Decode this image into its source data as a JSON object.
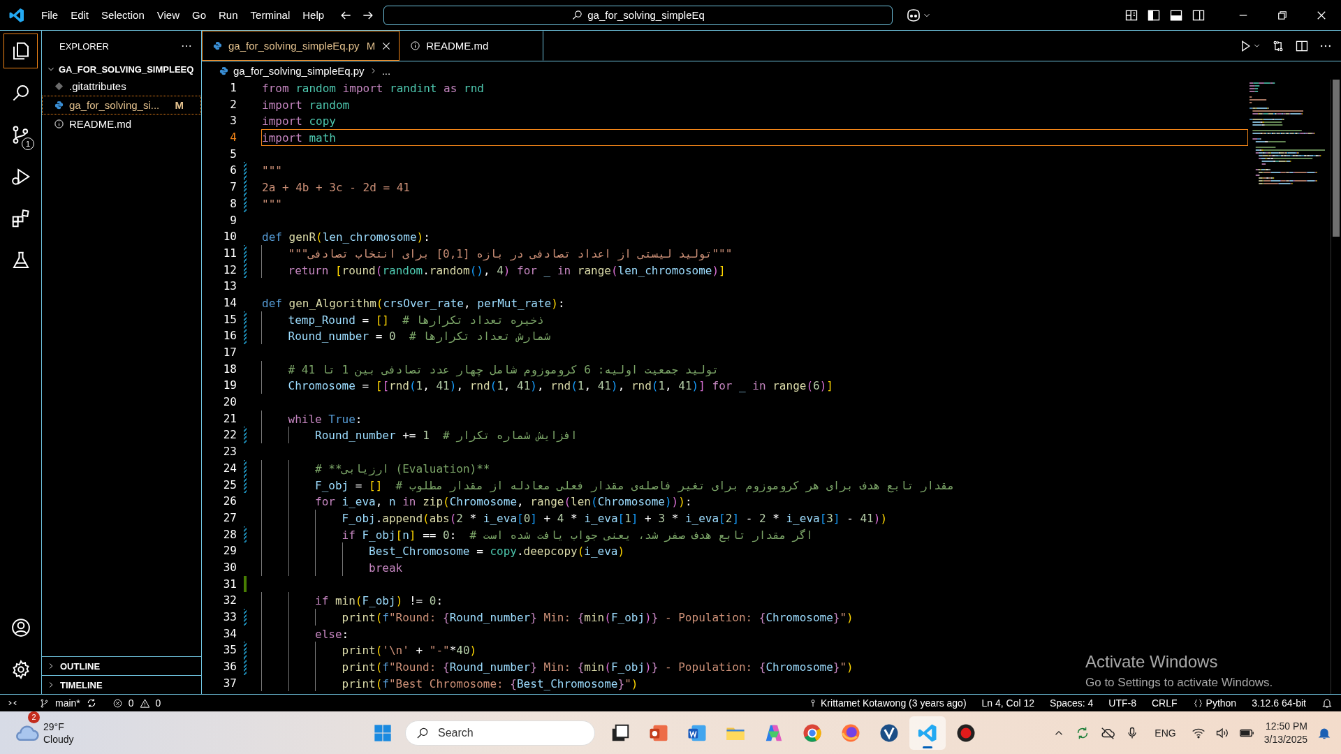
{
  "title_bar": {
    "menu": [
      "File",
      "Edit",
      "Selection",
      "View",
      "Go",
      "Run",
      "Terminal",
      "Help"
    ],
    "command_center": "ga_for_solving_simpleEq"
  },
  "activity_bar": {
    "items": [
      {
        "kind": "explorer",
        "selected": true
      },
      {
        "kind": "search",
        "selected": false
      },
      {
        "kind": "source-control",
        "selected": false,
        "badge": "1"
      },
      {
        "kind": "run",
        "selected": false
      },
      {
        "kind": "extensions",
        "selected": false
      },
      {
        "kind": "testing",
        "selected": false
      }
    ],
    "bottom": [
      {
        "kind": "account"
      },
      {
        "kind": "settings"
      }
    ]
  },
  "sidebar": {
    "title": "EXPLORER",
    "folder": {
      "name": "GA_FOR_SOLVING_SIMPLEEQ",
      "expanded": true,
      "children": [
        {
          "name": ".gitattributes",
          "kind": "git",
          "selected": false
        },
        {
          "name": "ga_for_solving_si...",
          "kind": "python",
          "selected": true,
          "status": "M"
        },
        {
          "name": "README.md",
          "kind": "info",
          "selected": false
        }
      ]
    },
    "sections": [
      {
        "name": "OUTLINE",
        "expanded": false
      },
      {
        "name": "TIMELINE",
        "expanded": false
      }
    ]
  },
  "tabs": [
    {
      "label": "ga_for_solving_simpleEq.py",
      "kind": "python",
      "status": "M",
      "selected": true
    },
    {
      "label": "README.md",
      "kind": "info",
      "selected": false
    }
  ],
  "breadcrumb": [
    "ga_for_solving_simpleEq.py",
    "..."
  ],
  "editor": {
    "lines": [
      {
        "number": "1",
        "tokens": [
          {
            "text": "from ",
            "kind": "keyword"
          },
          {
            "text": "random ",
            "kind": "module"
          },
          {
            "text": "import ",
            "kind": "keyword"
          },
          {
            "text": "randint ",
            "kind": "module"
          },
          {
            "text": "as ",
            "kind": "keyword"
          },
          {
            "text": "rnd",
            "kind": "module"
          }
        ]
      },
      {
        "number": "2",
        "tokens": [
          {
            "text": "import ",
            "kind": "keyword"
          },
          {
            "text": "random",
            "kind": "module"
          }
        ]
      },
      {
        "number": "3",
        "tokens": [
          {
            "text": "import ",
            "kind": "keyword"
          },
          {
            "text": "copy",
            "kind": "module"
          }
        ]
      },
      {
        "number": "4",
        "current": true,
        "tokens": [
          {
            "text": "import ",
            "kind": "keyword"
          },
          {
            "text": "math",
            "kind": "module"
          }
        ]
      },
      {
        "number": "5"
      },
      {
        "number": "6",
        "modified": true,
        "tokens": [
          {
            "text": "\"\"\"",
            "kind": "string"
          }
        ]
      },
      {
        "number": "7",
        "modified": true,
        "tokens": [
          {
            "text": "2a + 4b + 3c - 2d = 41",
            "kind": "string"
          }
        ]
      },
      {
        "number": "8",
        "modified": true,
        "tokens": [
          {
            "text": "\"\"\"",
            "kind": "string"
          }
        ]
      },
      {
        "number": "9"
      },
      {
        "number": "10",
        "tokens": [
          {
            "text": "def ",
            "kind": "storage"
          },
          {
            "text": "genR",
            "kind": "func"
          },
          {
            "text": "(",
            "kind": "br1"
          },
          {
            "text": "len_chromosome",
            "kind": "var"
          },
          {
            "text": ")",
            "kind": "br1"
          },
          {
            "text": ":",
            "kind": "plain"
          }
        ]
      },
      {
        "number": "11",
        "modified": true,
        "guides": [
          true
        ],
        "tokens": [
          {
            "text": "\"\"\"تولید لیستی از اعداد تصادفی در بازه [0,1] برای انتخاب تصادفی\"\"\"",
            "kind": "string"
          }
        ]
      },
      {
        "number": "12",
        "modified": true,
        "guides": [
          true
        ],
        "tokens": [
          {
            "text": "return ",
            "kind": "keyword"
          },
          {
            "text": "[",
            "kind": "br1"
          },
          {
            "text": "round",
            "kind": "func"
          },
          {
            "text": "(",
            "kind": "br2"
          },
          {
            "text": "random",
            "kind": "module"
          },
          {
            "text": ".",
            "kind": "plain"
          },
          {
            "text": "random",
            "kind": "func"
          },
          {
            "text": "()",
            "kind": "br3"
          },
          {
            "text": ", ",
            "kind": "plain"
          },
          {
            "text": "4",
            "kind": "number"
          },
          {
            "text": ")",
            "kind": "br2"
          },
          {
            "text": " for ",
            "kind": "keyword"
          },
          {
            "text": "_ ",
            "kind": "var"
          },
          {
            "text": "in ",
            "kind": "keyword"
          },
          {
            "text": "range",
            "kind": "func"
          },
          {
            "text": "(",
            "kind": "br2"
          },
          {
            "text": "len_chromosome",
            "kind": "var"
          },
          {
            "text": ")",
            "kind": "br2"
          },
          {
            "text": "]",
            "kind": "br1"
          }
        ]
      },
      {
        "number": "13"
      },
      {
        "number": "14",
        "tokens": [
          {
            "text": "def ",
            "kind": "storage"
          },
          {
            "text": "gen_Algorithm",
            "kind": "func"
          },
          {
            "text": "(",
            "kind": "br1"
          },
          {
            "text": "crsOver_rate",
            "kind": "var"
          },
          {
            "text": ", ",
            "kind": "plain"
          },
          {
            "text": "perMut_rate",
            "kind": "var"
          },
          {
            "text": ")",
            "kind": "br1"
          },
          {
            "text": ":",
            "kind": "plain"
          }
        ]
      },
      {
        "number": "15",
        "modified": true,
        "guides": [
          true
        ],
        "tokens": [
          {
            "text": "temp_Round",
            "kind": "var"
          },
          {
            "text": " = ",
            "kind": "plain"
          },
          {
            "text": "[]",
            "kind": "br1"
          },
          {
            "text": "  # ذخیره تعداد تکرارها",
            "kind": "comment"
          }
        ]
      },
      {
        "number": "16",
        "modified": true,
        "guides": [
          true
        ],
        "tokens": [
          {
            "text": "Round_number",
            "kind": "var"
          },
          {
            "text": " = ",
            "kind": "plain"
          },
          {
            "text": "0",
            "kind": "number"
          },
          {
            "text": "  # شمارش تعداد تکرارها",
            "kind": "comment"
          }
        ]
      },
      {
        "number": "17"
      },
      {
        "number": "18",
        "guides": [
          true
        ],
        "tokens": [
          {
            "text": "# تولید جمعیت اولیه: 6 کروموزوم شامل چهار عدد تصادفی بین 1 تا 41",
            "kind": "comment"
          }
        ]
      },
      {
        "number": "19",
        "guides": [
          true
        ],
        "tokens": [
          {
            "text": "Chromosome",
            "kind": "var"
          },
          {
            "text": " = ",
            "kind": "plain"
          },
          {
            "text": "[",
            "kind": "br1"
          },
          {
            "text": "[",
            "kind": "br2"
          },
          {
            "text": "rnd",
            "kind": "func"
          },
          {
            "text": "(",
            "kind": "br3"
          },
          {
            "text": "1",
            "kind": "number"
          },
          {
            "text": ", ",
            "kind": "plain"
          },
          {
            "text": "41",
            "kind": "number"
          },
          {
            "text": ")",
            "kind": "br3"
          },
          {
            "text": ", ",
            "kind": "plain"
          },
          {
            "text": "rnd",
            "kind": "func"
          },
          {
            "text": "(",
            "kind": "br3"
          },
          {
            "text": "1",
            "kind": "number"
          },
          {
            "text": ", ",
            "kind": "plain"
          },
          {
            "text": "41",
            "kind": "number"
          },
          {
            "text": ")",
            "kind": "br3"
          },
          {
            "text": ", ",
            "kind": "plain"
          },
          {
            "text": "rnd",
            "kind": "func"
          },
          {
            "text": "(",
            "kind": "br3"
          },
          {
            "text": "1",
            "kind": "number"
          },
          {
            "text": ", ",
            "kind": "plain"
          },
          {
            "text": "41",
            "kind": "number"
          },
          {
            "text": ")",
            "kind": "br3"
          },
          {
            "text": ", ",
            "kind": "plain"
          },
          {
            "text": "rnd",
            "kind": "func"
          },
          {
            "text": "(",
            "kind": "br3"
          },
          {
            "text": "1",
            "kind": "number"
          },
          {
            "text": ", ",
            "kind": "plain"
          },
          {
            "text": "41",
            "kind": "number"
          },
          {
            "text": ")",
            "kind": "br3"
          },
          {
            "text": "]",
            "kind": "br2"
          },
          {
            "text": " for ",
            "kind": "keyword"
          },
          {
            "text": "_ ",
            "kind": "var"
          },
          {
            "text": "in ",
            "kind": "keyword"
          },
          {
            "text": "range",
            "kind": "func"
          },
          {
            "text": "(",
            "kind": "br2"
          },
          {
            "text": "6",
            "kind": "number"
          },
          {
            "text": ")",
            "kind": "br2"
          },
          {
            "text": "]",
            "kind": "br1"
          }
        ]
      },
      {
        "number": "20"
      },
      {
        "number": "21",
        "guides": [
          true
        ],
        "tokens": [
          {
            "text": "while ",
            "kind": "keyword"
          },
          {
            "text": "True",
            "kind": "storage"
          },
          {
            "text": ":",
            "kind": "plain"
          }
        ]
      },
      {
        "number": "22",
        "modified": true,
        "guides": [
          true,
          true
        ],
        "tokens": [
          {
            "text": "Round_number",
            "kind": "var"
          },
          {
            "text": " += ",
            "kind": "plain"
          },
          {
            "text": "1",
            "kind": "number"
          },
          {
            "text": "  # افزایش شماره تکرار",
            "kind": "comment"
          }
        ]
      },
      {
        "number": "23"
      },
      {
        "number": "24",
        "modified": true,
        "guides": [
          true,
          true
        ],
        "tokens": [
          {
            "text": "# **ارزیابی (Evaluation)**",
            "kind": "comment"
          }
        ]
      },
      {
        "number": "25",
        "modified": true,
        "guides": [
          true,
          true
        ],
        "tokens": [
          {
            "text": "F_obj",
            "kind": "var"
          },
          {
            "text": " = ",
            "kind": "plain"
          },
          {
            "text": "[]",
            "kind": "br1"
          },
          {
            "text": "  # مقدار تابع هدف برای هر کروموزوم برای تغیر فاصله‌ی مقدار فعلی معادله از مقدار مطلوب",
            "kind": "comment"
          }
        ]
      },
      {
        "number": "26",
        "guides": [
          true,
          true
        ],
        "tokens": [
          {
            "text": "for ",
            "kind": "keyword"
          },
          {
            "text": "i_eva",
            "kind": "var"
          },
          {
            "text": ", ",
            "kind": "plain"
          },
          {
            "text": "n ",
            "kind": "var"
          },
          {
            "text": "in ",
            "kind": "keyword"
          },
          {
            "text": "zip",
            "kind": "func"
          },
          {
            "text": "(",
            "kind": "br1"
          },
          {
            "text": "Chromosome",
            "kind": "var"
          },
          {
            "text": ", ",
            "kind": "plain"
          },
          {
            "text": "range",
            "kind": "func"
          },
          {
            "text": "(",
            "kind": "br2"
          },
          {
            "text": "len",
            "kind": "func"
          },
          {
            "text": "(",
            "kind": "br3"
          },
          {
            "text": "Chromosome",
            "kind": "var"
          },
          {
            "text": ")",
            "kind": "br3"
          },
          {
            "text": ")",
            "kind": "br2"
          },
          {
            "text": ")",
            "kind": "br1"
          },
          {
            "text": ":",
            "kind": "plain"
          }
        ]
      },
      {
        "number": "27",
        "guides": [
          true,
          true,
          true
        ],
        "tokens": [
          {
            "text": "F_obj",
            "kind": "var"
          },
          {
            "text": ".",
            "kind": "plain"
          },
          {
            "text": "append",
            "kind": "func"
          },
          {
            "text": "(",
            "kind": "br1"
          },
          {
            "text": "abs",
            "kind": "func"
          },
          {
            "text": "(",
            "kind": "br2"
          },
          {
            "text": "2",
            "kind": "number"
          },
          {
            "text": " * ",
            "kind": "plain"
          },
          {
            "text": "i_eva",
            "kind": "var"
          },
          {
            "text": "[",
            "kind": "br3"
          },
          {
            "text": "0",
            "kind": "number"
          },
          {
            "text": "]",
            "kind": "br3"
          },
          {
            "text": " + ",
            "kind": "plain"
          },
          {
            "text": "4",
            "kind": "number"
          },
          {
            "text": " * ",
            "kind": "plain"
          },
          {
            "text": "i_eva",
            "kind": "var"
          },
          {
            "text": "[",
            "kind": "br3"
          },
          {
            "text": "1",
            "kind": "number"
          },
          {
            "text": "]",
            "kind": "br3"
          },
          {
            "text": " + ",
            "kind": "plain"
          },
          {
            "text": "3",
            "kind": "number"
          },
          {
            "text": " * ",
            "kind": "plain"
          },
          {
            "text": "i_eva",
            "kind": "var"
          },
          {
            "text": "[",
            "kind": "br3"
          },
          {
            "text": "2",
            "kind": "number"
          },
          {
            "text": "]",
            "kind": "br3"
          },
          {
            "text": " - ",
            "kind": "plain"
          },
          {
            "text": "2",
            "kind": "number"
          },
          {
            "text": " * ",
            "kind": "plain"
          },
          {
            "text": "i_eva",
            "kind": "var"
          },
          {
            "text": "[",
            "kind": "br3"
          },
          {
            "text": "3",
            "kind": "number"
          },
          {
            "text": "]",
            "kind": "br3"
          },
          {
            "text": " - ",
            "kind": "plain"
          },
          {
            "text": "41",
            "kind": "number"
          },
          {
            "text": ")",
            "kind": "br2"
          },
          {
            "text": ")",
            "kind": "br1"
          }
        ]
      },
      {
        "number": "28",
        "modified": true,
        "guides": [
          true,
          true,
          true
        ],
        "tokens": [
          {
            "text": "if ",
            "kind": "keyword"
          },
          {
            "text": "F_obj",
            "kind": "var"
          },
          {
            "text": "[",
            "kind": "br1"
          },
          {
            "text": "n",
            "kind": "var"
          },
          {
            "text": "]",
            "kind": "br1"
          },
          {
            "text": " == ",
            "kind": "plain"
          },
          {
            "text": "0",
            "kind": "number"
          },
          {
            "text": ":  ",
            "kind": "plain"
          },
          {
            "text": "# اگر مقدار تابع هدف صفر شد، یعنی جواب یافت شده است",
            "kind": "comment"
          }
        ]
      },
      {
        "number": "29",
        "guides": [
          true,
          true,
          true,
          true
        ],
        "tokens": [
          {
            "text": "Best_Chromosome",
            "kind": "var"
          },
          {
            "text": " = ",
            "kind": "plain"
          },
          {
            "text": "copy",
            "kind": "module"
          },
          {
            "text": ".",
            "kind": "plain"
          },
          {
            "text": "deepcopy",
            "kind": "func"
          },
          {
            "text": "(",
            "kind": "br1"
          },
          {
            "text": "i_eva",
            "kind": "var"
          },
          {
            "text": ")",
            "kind": "br1"
          }
        ]
      },
      {
        "number": "30",
        "guides": [
          true,
          true,
          true,
          true
        ],
        "tokens": [
          {
            "text": "break",
            "kind": "keyword"
          }
        ]
      },
      {
        "number": "31",
        "added": true
      },
      {
        "number": "32",
        "guides": [
          true,
          true
        ],
        "tokens": [
          {
            "text": "if ",
            "kind": "keyword"
          },
          {
            "text": "min",
            "kind": "func"
          },
          {
            "text": "(",
            "kind": "br1"
          },
          {
            "text": "F_obj",
            "kind": "var"
          },
          {
            "text": ")",
            "kind": "br1"
          },
          {
            "text": " != ",
            "kind": "plain"
          },
          {
            "text": "0",
            "kind": "number"
          },
          {
            "text": ":",
            "kind": "plain"
          }
        ]
      },
      {
        "number": "33",
        "modified": true,
        "guides": [
          true,
          true,
          true
        ],
        "tokens": [
          {
            "text": "print",
            "kind": "func"
          },
          {
            "text": "(",
            "kind": "br1"
          },
          {
            "text": "f",
            "kind": "storage"
          },
          {
            "text": "\"Round: ",
            "kind": "string"
          },
          {
            "text": "{",
            "kind": "keyword"
          },
          {
            "text": "Round_number",
            "kind": "var"
          },
          {
            "text": "}",
            "kind": "keyword"
          },
          {
            "text": " Min: ",
            "kind": "string"
          },
          {
            "text": "{",
            "kind": "keyword"
          },
          {
            "text": "min",
            "kind": "func"
          },
          {
            "text": "(",
            "kind": "br2"
          },
          {
            "text": "F_obj",
            "kind": "var"
          },
          {
            "text": ")",
            "kind": "br2"
          },
          {
            "text": "}",
            "kind": "keyword"
          },
          {
            "text": " - Population: ",
            "kind": "string"
          },
          {
            "text": "{",
            "kind": "keyword"
          },
          {
            "text": "Chromosome",
            "kind": "var"
          },
          {
            "text": "}",
            "kind": "keyword"
          },
          {
            "text": "\"",
            "kind": "string"
          },
          {
            "text": ")",
            "kind": "br1"
          }
        ]
      },
      {
        "number": "34",
        "guides": [
          true,
          true
        ],
        "tokens": [
          {
            "text": "else",
            "kind": "keyword"
          },
          {
            "text": ":",
            "kind": "plain"
          }
        ]
      },
      {
        "number": "35",
        "modified": true,
        "guides": [
          true,
          true,
          true
        ],
        "tokens": [
          {
            "text": "print",
            "kind": "func"
          },
          {
            "text": "(",
            "kind": "br1"
          },
          {
            "text": "'\\n'",
            "kind": "string"
          },
          {
            "text": " + ",
            "kind": "plain"
          },
          {
            "text": "\"-\"",
            "kind": "string"
          },
          {
            "text": "*",
            "kind": "plain"
          },
          {
            "text": "40",
            "kind": "number"
          },
          {
            "text": ")",
            "kind": "br1"
          }
        ]
      },
      {
        "number": "36",
        "modified": true,
        "guides": [
          true,
          true,
          true
        ],
        "tokens": [
          {
            "text": "print",
            "kind": "func"
          },
          {
            "text": "(",
            "kind": "br1"
          },
          {
            "text": "f",
            "kind": "storage"
          },
          {
            "text": "\"Round: ",
            "kind": "string"
          },
          {
            "text": "{",
            "kind": "keyword"
          },
          {
            "text": "Round_number",
            "kind": "var"
          },
          {
            "text": "}",
            "kind": "keyword"
          },
          {
            "text": " Min: ",
            "kind": "string"
          },
          {
            "text": "{",
            "kind": "keyword"
          },
          {
            "text": "min",
            "kind": "func"
          },
          {
            "text": "(",
            "kind": "br2"
          },
          {
            "text": "F_obj",
            "kind": "var"
          },
          {
            "text": ")",
            "kind": "br2"
          },
          {
            "text": "}",
            "kind": "keyword"
          },
          {
            "text": " - Population: ",
            "kind": "string"
          },
          {
            "text": "{",
            "kind": "keyword"
          },
          {
            "text": "Chromosome",
            "kind": "var"
          },
          {
            "text": "}",
            "kind": "keyword"
          },
          {
            "text": "\"",
            "kind": "string"
          },
          {
            "text": ")",
            "kind": "br1"
          }
        ]
      },
      {
        "number": "37",
        "guides": [
          true,
          true,
          true
        ],
        "tokens": [
          {
            "text": "print",
            "kind": "func"
          },
          {
            "text": "(",
            "kind": "br1"
          },
          {
            "text": "f",
            "kind": "storage"
          },
          {
            "text": "\"Best Chromosome: ",
            "kind": "string"
          },
          {
            "text": "{",
            "kind": "keyword"
          },
          {
            "text": "Best_Chromosome",
            "kind": "var"
          },
          {
            "text": "}",
            "kind": "keyword"
          },
          {
            "text": "\"",
            "kind": "string"
          },
          {
            "text": ")",
            "kind": "br1"
          }
        ]
      }
    ]
  },
  "activation_notice": {
    "title": "Activate Windows",
    "text": "Go to Settings to activate Windows."
  },
  "status_bar": {
    "branch": "main*",
    "errors": "0",
    "warnings": "0",
    "blame": "Krittamet Kotawong (3 years ago)",
    "items": [
      "Ln 4, Col 12",
      "Spaces: 4",
      "UTF-8",
      "CRLF"
    ],
    "language": "Python",
    "interpreter": "3.12.6 64-bit"
  },
  "taskbar": {
    "weather": {
      "badge": "2",
      "temperature": "29°F",
      "condition": "Cloudy"
    },
    "search": {
      "placeholder": "Search"
    },
    "apps": [
      {
        "kind": "task-view",
        "active": false
      },
      {
        "kind": "slides",
        "active": false
      },
      {
        "kind": "document",
        "active": false
      },
      {
        "kind": "folder",
        "active": false
      },
      {
        "kind": "assistant",
        "active": false
      },
      {
        "kind": "browser-circle",
        "active": false
      },
      {
        "kind": "browser-fox",
        "active": false
      },
      {
        "kind": "check-circle",
        "active": false
      },
      {
        "kind": "code-editor",
        "active": true
      },
      {
        "kind": "recorder",
        "active": false
      }
    ],
    "language": "ENG",
    "time": "12:50 PM",
    "date": "3/13/2025"
  }
}
